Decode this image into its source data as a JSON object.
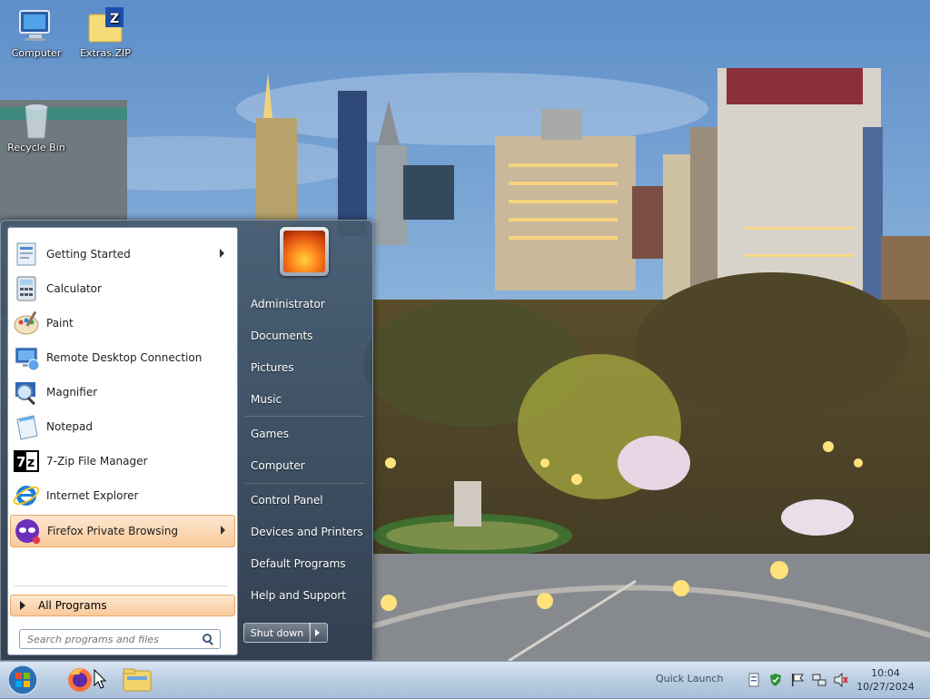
{
  "desktop": {
    "icons": [
      {
        "label": "Computer"
      },
      {
        "label": "Extras.ZIP"
      },
      {
        "label": "Recycle Bin"
      }
    ]
  },
  "start_menu": {
    "programs": [
      {
        "label": "Getting Started",
        "icon": "getting-started-icon",
        "submenu": true
      },
      {
        "label": "Calculator",
        "icon": "calculator-icon"
      },
      {
        "label": "Paint",
        "icon": "paint-icon"
      },
      {
        "label": "Remote Desktop Connection",
        "icon": "remote-desktop-icon"
      },
      {
        "label": "Magnifier",
        "icon": "magnifier-icon"
      },
      {
        "label": "Notepad",
        "icon": "notepad-icon"
      },
      {
        "label": "7-Zip File Manager",
        "icon": "7zip-icon"
      },
      {
        "label": "Internet Explorer",
        "icon": "internet-explorer-icon"
      },
      {
        "label": "Firefox Private Browsing",
        "icon": "firefox-private-icon",
        "submenu": true,
        "highlighted": true
      }
    ],
    "all_programs": "All Programs",
    "search_placeholder": "Search programs and files",
    "right_links": [
      "Administrator",
      "Documents",
      "Pictures",
      "Music",
      "Games",
      "Computer",
      "Control Panel",
      "Devices and Printers",
      "Default Programs",
      "Help and Support"
    ],
    "shutdown_label": "Shut down"
  },
  "taskbar": {
    "quick_launch": "Quick Launch",
    "time": "10:04",
    "date": "10/27/2024"
  },
  "colors": {
    "highlight": "#f9c99b",
    "taskbar": "#b9cde2",
    "menu_dark": "#34485e"
  }
}
